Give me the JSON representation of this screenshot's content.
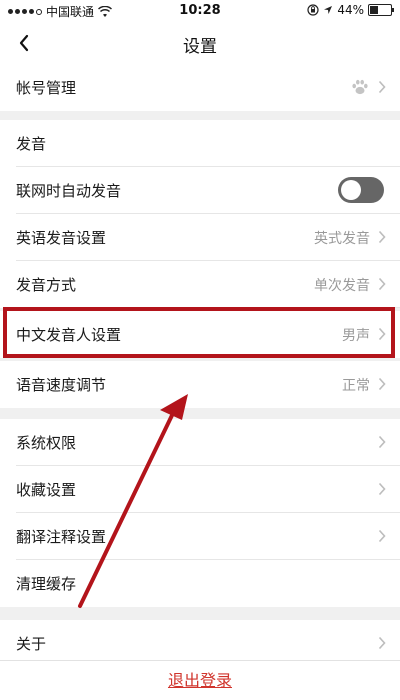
{
  "status_bar": {
    "carrier": "中国联通",
    "time": "10:28",
    "battery": "44%",
    "battery_level": 0.44,
    "icons": [
      "signal-icon",
      "wifi-icon",
      "lock-icon",
      "location-icon",
      "battery-icon"
    ]
  },
  "nav": {
    "title": "设置",
    "back_icon": "chevron-left-icon"
  },
  "rows": {
    "account": {
      "label": "帐号管理",
      "icon": "paw-icon"
    },
    "section_pronunciation": {
      "label": "发音"
    },
    "auto_pronounce": {
      "label": "联网时自动发音",
      "toggle_on": false
    },
    "english_pronounce": {
      "label": "英语发音设置",
      "value": "英式发音"
    },
    "pronounce_mode": {
      "label": "发音方式",
      "value": "单次发音"
    },
    "chinese_speaker": {
      "label": "中文发音人设置",
      "value": "男声"
    },
    "speech_speed": {
      "label": "语音速度调节",
      "value": "正常"
    },
    "permissions": {
      "label": "系统权限"
    },
    "favorites": {
      "label": "收藏设置"
    },
    "translation_notes": {
      "label": "翻译注释设置"
    },
    "clear_cache": {
      "label": "清理缓存"
    },
    "about": {
      "label": "关于"
    }
  },
  "logout": {
    "label": "退出登录"
  },
  "colors": {
    "highlight": "#b3141b",
    "arrow": "#b3141b",
    "logout": "#d0342c",
    "toggle_off": "#666666"
  }
}
